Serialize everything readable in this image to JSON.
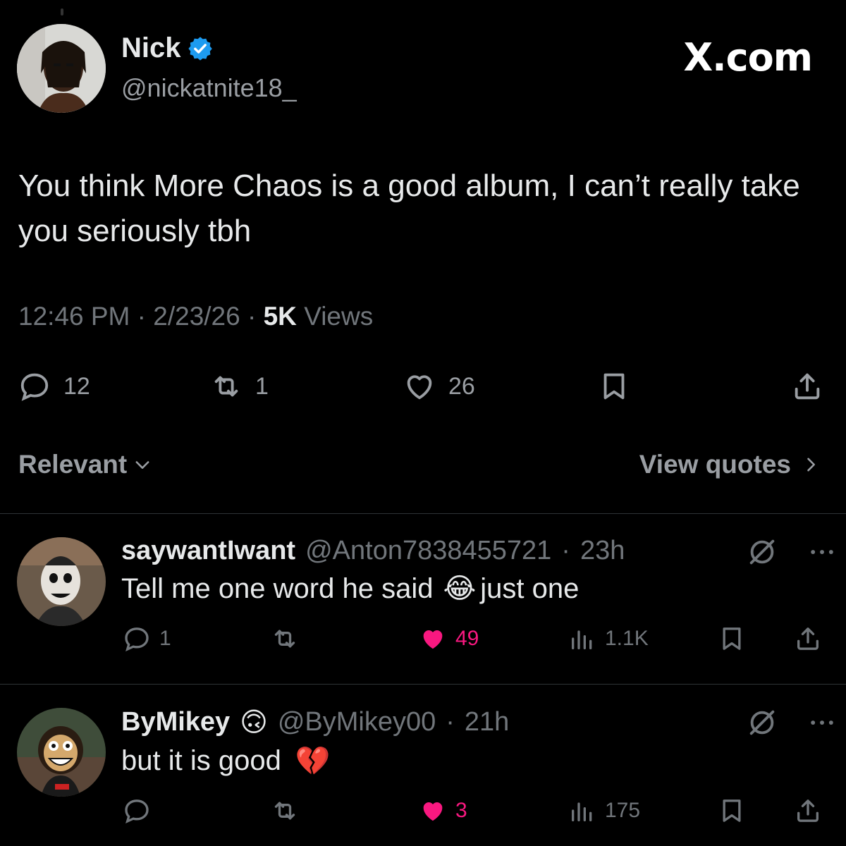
{
  "brand": "X.com",
  "tweet": {
    "author_name": "Nick",
    "author_handle": "@nickatnite18_",
    "text": "You think More Chaos is a good album, I can’t really take you seriously tbh",
    "time": "12:46 PM",
    "date": "2/23/26",
    "views_count": "5K",
    "views_label": "Views",
    "replies": "12",
    "reposts": "1",
    "likes": "26"
  },
  "sort": {
    "label": "Relevant",
    "view_quotes": "View quotes"
  },
  "replies": [
    {
      "name": "saywantIwant",
      "handle": "@Anton7838455721",
      "time": "23h",
      "text_before": "Tell me one word he said",
      "emoji": "😂",
      "text_after": "just one",
      "replies": "1",
      "reposts": "",
      "likes": "49",
      "views": "1.1K"
    },
    {
      "name": "ByMikey",
      "name_emoji": "🙃",
      "handle": "@ByMikey00",
      "time": "21h",
      "text_before": "but it is good",
      "emoji": "💔",
      "text_after": "",
      "replies": "",
      "reposts": "",
      "likes": "3",
      "views": "175"
    }
  ],
  "colors": {
    "background": "#000000",
    "text": "#e7e9ea",
    "muted": "#71767b",
    "verified": "#1d9bf0",
    "like": "#f91880"
  }
}
